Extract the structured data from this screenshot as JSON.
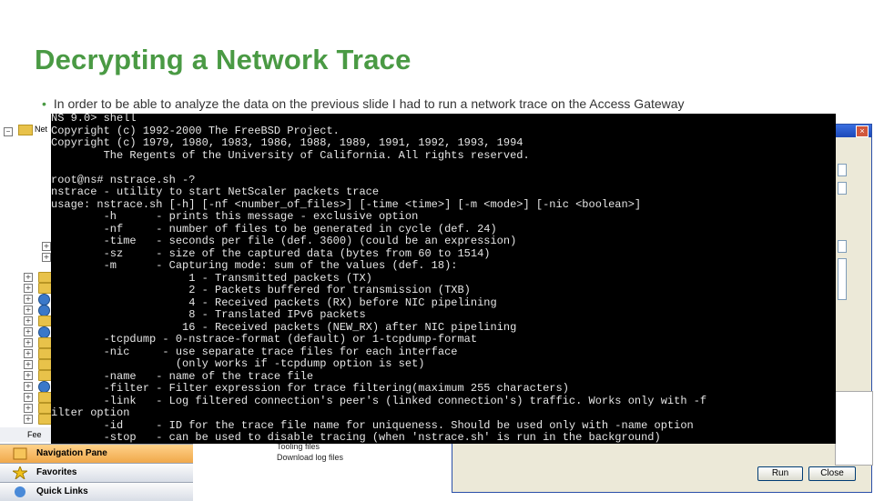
{
  "slide": {
    "title": "Decrypting a Network Trace",
    "bullet": "In order to be able to analyze the data on the previous slide I had to run a network trace on the Access Gateway"
  },
  "background_ui": {
    "tree_top_label": "Net",
    "nav_status_text": "Fee",
    "nav_buttons": [
      "Navigation Pane",
      "Favorites",
      "Quick Links"
    ],
    "middle_items": [
      "Tooling files",
      "Download log files"
    ],
    "dialog_buttons": [
      "Run",
      "Close"
    ]
  },
  "terminal": {
    "lines": [
      "NS 9.0> shell",
      "Copyright (c) 1992-2000 The FreeBSD Project.",
      "Copyright (c) 1979, 1980, 1983, 1986, 1988, 1989, 1991, 1992, 1993, 1994",
      "        The Regents of the University of California. All rights reserved.",
      "",
      "root@ns# nstrace.sh -?",
      "nstrace - utility to start NetScaler packets trace",
      "usage: nstrace.sh [-h] [-nf <number_of_files>] [-time <time>] [-m <mode>] [-nic <boolean>]",
      "        -h      - prints this message - exclusive option",
      "        -nf     - number of files to be generated in cycle (def. 24)",
      "        -time   - seconds per file (def. 3600) (could be an expression)",
      "        -sz     - size of the captured data (bytes from 60 to 1514)",
      "        -m      - Capturing mode: sum of the values (def. 18):",
      "                     1 - Transmitted packets (TX)",
      "                     2 - Packets buffered for transmission (TXB)",
      "                     4 - Received packets (RX) before NIC pipelining",
      "                     8 - Translated IPv6 packets",
      "                    16 - Received packets (NEW_RX) after NIC pipelining",
      "        -tcpdump - 0-nstrace-format (default) or 1-tcpdump-format",
      "        -nic     - use separate trace files for each interface",
      "                   (only works if -tcpdump option is set)",
      "        -name   - name of the trace file",
      "        -filter - Filter expression for trace filtering(maximum 255 characters)",
      "        -link   - Log filtered connection's peer's (linked connection's) traffic. Works only with -f",
      "ilter option",
      "        -id     - ID for the trace file name for uniqueness. Should be used only with -name option",
      "        -stop   - can be used to disable tracing (when 'nstrace.sh' is run in the background)"
    ]
  }
}
